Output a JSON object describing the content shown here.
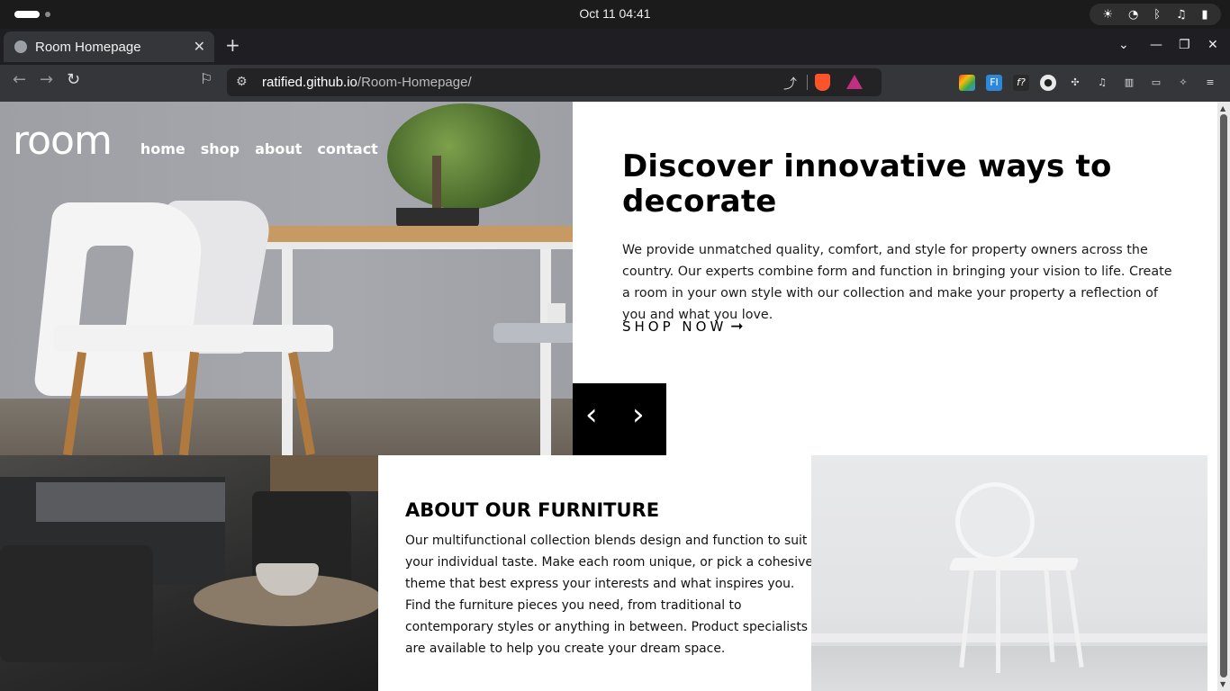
{
  "system_bar": {
    "clock": "Oct 11  04:41",
    "tray_icons": [
      "brightness-icon",
      "wifi-icon",
      "bluetooth-icon",
      "volume-icon",
      "battery-icon"
    ]
  },
  "browser": {
    "tab_title": "Room Homepage",
    "url_host": "ratified.github.io",
    "url_path": "/Room-Homepage/",
    "extensions": [
      "google-calendar-icon",
      "ff-extension-icon",
      "formula-extension-icon",
      "circle-extension-icon",
      "puzzle-icon",
      "music-icon",
      "sidebar-icon",
      "wallet-icon",
      "leo-ai-icon",
      "menu-icon"
    ]
  },
  "site": {
    "logo": "room",
    "nav": [
      "home",
      "shop",
      "about",
      "contact"
    ],
    "hero": {
      "title": "Discover innovative ways to decorate",
      "body": "We provide unmatched quality, comfort, and style for property owners across the country. Our experts combine form and function in bringing your vision to life. Create a room in your own style with our collection and make your property a reflection of you and what you love.",
      "cta": "SHOP NOW",
      "cta_arrow": "➞"
    },
    "slider": {
      "prev": "‹",
      "next": "›"
    },
    "about": {
      "title": "ABOUT OUR FURNITURE",
      "body": "Our multifunctional collection blends design and function to suit your individual taste. Make each room unique, or pick a cohesive theme that best express your interests and what inspires you. Find the furniture pieces you need, from traditional to contemporary styles or anything in between. Product specialists are available to help you create your dream space."
    }
  },
  "colors": {
    "page_bg": "#ffffff",
    "text": "#000000",
    "slider_bg": "#000000",
    "browser_chrome": "#35363a"
  }
}
